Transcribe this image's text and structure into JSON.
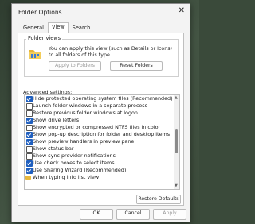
{
  "window": {
    "title": "Folder Options",
    "close_glyph": "✕"
  },
  "tabs": [
    {
      "label": "General"
    },
    {
      "label": "View"
    },
    {
      "label": "Search"
    }
  ],
  "folder_views": {
    "title": "Folder views",
    "description": "You can apply this view (such as Details or Icons) to all folders of this type.",
    "apply_button": "Apply to Folders",
    "reset_button": "Reset Folders"
  },
  "advanced": {
    "label": "Advanced settings:",
    "items": [
      {
        "label": "Hide protected operating system files (Recommended)",
        "checked": true
      },
      {
        "label": "Launch folder windows in a separate process",
        "checked": false
      },
      {
        "label": "Restore previous folder windows at logon",
        "checked": false
      },
      {
        "label": "Show drive letters",
        "checked": true
      },
      {
        "label": "Show encrypted or compressed NTFS files in color",
        "checked": false
      },
      {
        "label": "Show pop-up description for folder and desktop items",
        "checked": true
      },
      {
        "label": "Show preview handlers in preview pane",
        "checked": true
      },
      {
        "label": "Show status bar",
        "checked": false
      },
      {
        "label": "Show sync provider notifications",
        "checked": false
      },
      {
        "label": "Use check boxes to select items",
        "checked": true
      },
      {
        "label": "Use Sharing Wizard (Recommended)",
        "checked": true
      },
      {
        "label": "When typing into list view",
        "folder": true
      }
    ],
    "restore_button": "Restore Defaults"
  },
  "footer": {
    "ok": "OK",
    "cancel": "Cancel",
    "apply": "Apply"
  }
}
